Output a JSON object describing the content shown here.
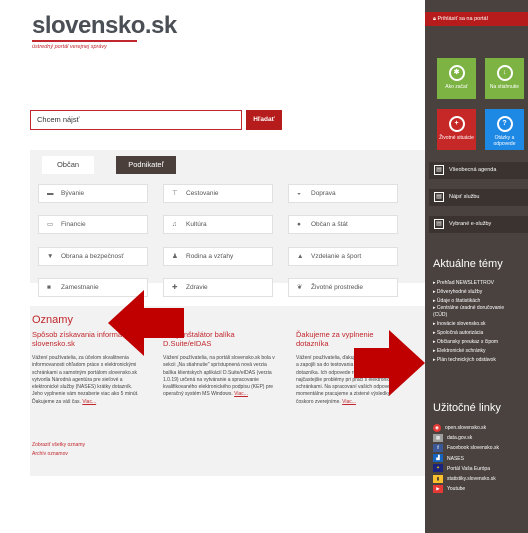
{
  "logo": {
    "title": "slovensko.sk",
    "subtitle": "ústredný portál verejnej správy"
  },
  "search": {
    "placeholder": "Chcem nájsť",
    "button": "Hľadať"
  },
  "tabs": {
    "active": "Občan",
    "other": "Podnikateľ"
  },
  "categories": [
    {
      "label": "Bývanie",
      "icon": "chair-icon"
    },
    {
      "label": "Cestovanie",
      "icon": "signpost-icon"
    },
    {
      "label": "Doprava",
      "icon": "car-icon"
    },
    {
      "label": "Financie",
      "icon": "money-icon"
    },
    {
      "label": "Kultúra",
      "icon": "music-icon"
    },
    {
      "label": "Občan a štát",
      "icon": "people-icon"
    },
    {
      "label": "Obrana a bezpečnosť",
      "icon": "shield-icon"
    },
    {
      "label": "Rodina a vzťahy",
      "icon": "family-icon"
    },
    {
      "label": "Vzdelanie a šport",
      "icon": "graduation-icon"
    },
    {
      "label": "Zamestnanie",
      "icon": "briefcase-icon"
    },
    {
      "label": "Zdravie",
      "icon": "health-icon"
    },
    {
      "label": "Životné prostredie",
      "icon": "leaf-icon"
    }
  ],
  "news": {
    "heading": "Oznamy",
    "items": [
      {
        "title": "Spôsob získavania informácií slovensko.sk",
        "body": "Vážení používatelia, za účelom skvalitnenia informovanosti ohľadom práce s elektronickými schránkami a samotným portálom slovensko.sk vytvorila Národná agentúra pre sieťové a elektronické služby (NASES) krátky dotazník. Jeho vyplnenie vám nezaberie viac ako 5 minút. Ďakujeme za váš čas.",
        "link": "Viac..."
      },
      {
        "title": "Nový inštalátor balíka D.Suite/eIDAS",
        "body": "Vážení používatelia, na portáli slovensko.sk bola v sekcii „Na stiahnutie\" sprístupnená nová verzia balíka klientskych aplikácií D.Suite/eIDAS (verzia 1.0.19) určená na vytváranie a spracovanie kvalifikovaného elektronického podpisu (KEP) pre operačný systém MS Windows.",
        "link": "Viac..."
      },
      {
        "title": "Ďakujeme za vyplnenie dotazníka",
        "body": "Vážení používatelia, ďakujeme, že ste si našli čas a zapojili sa do testovania prostredníctvom dotazníka. Ich odpovede nám identifikovať najčastejšie problémy pri práci s elektronickými schránkami. Na spracovaní vašich odpovedí momentálne pracujeme a zistené výsledky čoskoro zverejníme.",
        "link": "Viac..."
      }
    ],
    "show_all": "Zobraziť všetky oznamy",
    "archive": "Archív oznamov"
  },
  "sidebar": {
    "login": "Prihlásiť sa na portál",
    "tiles": [
      {
        "label": "Ako začať",
        "color": "#7cb342",
        "icon": "bulb-icon"
      },
      {
        "label": "Na stiahnutie",
        "color": "#7cb342",
        "icon": "download-icon"
      },
      {
        "label": "Životné situácie",
        "color": "#c62828",
        "icon": "life-ring-icon"
      },
      {
        "label": "Otázky a odpovede",
        "color": "#1e88e5",
        "icon": "question-icon"
      }
    ],
    "buttons": [
      {
        "label": "Všeobecná agenda",
        "icon": "document-icon"
      },
      {
        "label": "Nájsť službu",
        "icon": "search-service-icon"
      },
      {
        "label": "Vybrané e-služby",
        "icon": "services-icon"
      }
    ],
    "topics_heading": "Aktuálne témy",
    "topics": [
      "Prehľad NEWSLETTROV",
      "Dôveryhodné služby",
      "Údaje o štatistikách",
      "Centrálne úradné doručovanie (CÚD)",
      "Inovácie slovensko.sk",
      "Spoločná autorizácia",
      "Občiansky preukaz s čipom",
      "Elektronické schránky",
      "Plán technických odstávok"
    ],
    "links_heading": "Užitočné linky",
    "links": [
      {
        "label": "open.slovensko.sk",
        "icon": "open-icon"
      },
      {
        "label": "data.gov.sk",
        "icon": "data-icon"
      },
      {
        "label": "Facebook slovensko.sk",
        "icon": "facebook-icon"
      },
      {
        "label": "NASES",
        "icon": "nases-icon"
      },
      {
        "label": "Portál Vaša Európa",
        "icon": "eu-icon"
      },
      {
        "label": "statistiky.slovensko.sk",
        "icon": "stats-icon"
      },
      {
        "label": "Youtube",
        "icon": "youtube-icon"
      }
    ]
  }
}
